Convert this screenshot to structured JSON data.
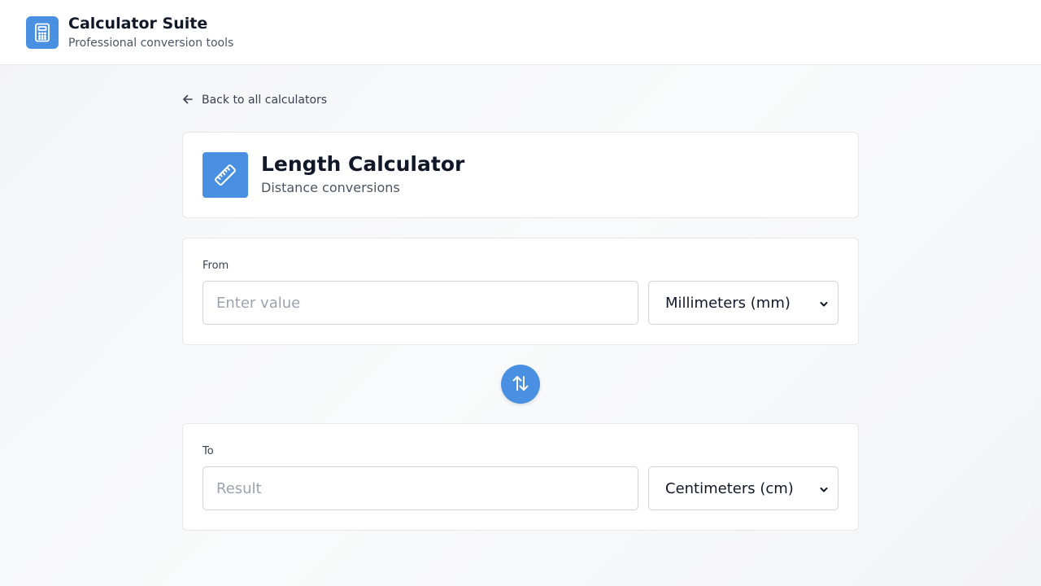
{
  "header": {
    "title": "Calculator Suite",
    "subtitle": "Professional conversion tools",
    "icon": "calculator-icon"
  },
  "back_link": {
    "label": "Back to all calculators",
    "icon": "arrow-left-icon"
  },
  "calculator": {
    "title": "Length Calculator",
    "subtitle": "Distance conversions",
    "icon": "ruler-icon",
    "accent_color": "#4a90e2"
  },
  "from": {
    "label": "From",
    "value": "",
    "placeholder": "Enter value",
    "unit": "Millimeters (mm)"
  },
  "swap": {
    "icon": "swap-vertical-icon"
  },
  "to": {
    "label": "To",
    "value": "",
    "placeholder": "Result",
    "unit": "Centimeters (cm)"
  }
}
